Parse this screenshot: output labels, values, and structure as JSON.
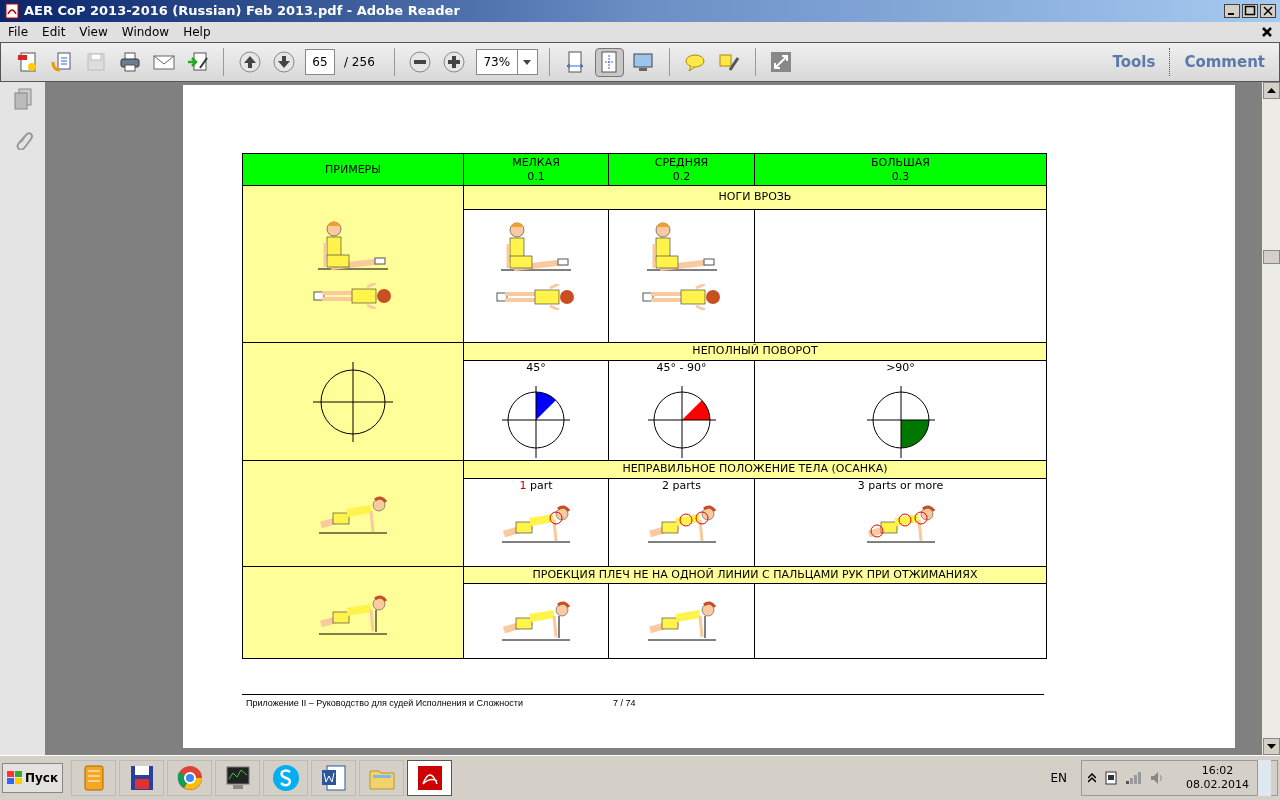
{
  "window": {
    "title": "AER CoP 2013-2016 (Russian) Feb 2013.pdf - Adobe Reader"
  },
  "menu": [
    "File",
    "Edit",
    "View",
    "Window",
    "Help"
  ],
  "toolbar": {
    "page_number": "65",
    "page_total": "/ 256",
    "zoom": "73%",
    "fit_page_selected": true,
    "save_disabled": true,
    "panels": [
      "Tools",
      "Comment"
    ]
  },
  "table": {
    "columns": [
      {
        "label": "ПРИМЕРЫ"
      },
      {
        "label": "МЕЛКАЯ",
        "value": "0.1"
      },
      {
        "label": "СРЕДНЯЯ",
        "value": "0.2"
      },
      {
        "label": "БОЛЬШАЯ",
        "value": "0.3"
      }
    ],
    "sections": [
      {
        "title": "НОГИ ВРОЗЬ"
      },
      {
        "title": "НЕПОЛНЫЙ ПОВОРОТ",
        "cells": [
          {
            "label": "45°",
            "color": "#0000ff"
          },
          {
            "label": "45°  - 90°",
            "color": "#ff0000"
          },
          {
            "label": ">90°",
            "color": "#007700"
          }
        ]
      },
      {
        "title": "НЕПРАВИЛЬНОЕ ПОЛОЖЕНИЕ ТЕЛА (ОСАНКА)",
        "cells": [
          {
            "label": "1 part",
            "number_red": true
          },
          {
            "label": "2 parts",
            "number_red": false
          },
          {
            "label": "3 parts or more",
            "number_red": false
          }
        ]
      },
      {
        "title": "ПРОЕКЦИЯ ПЛЕЧ НЕ НА ОДНОЙ ЛИНИИ С ПАЛЬЦАМИ РУК ПРИ ОТЖИМАНИЯХ"
      }
    ]
  },
  "footer": {
    "text": "Приложение II – Руководство для судей Исполнения и Сложности",
    "page": "7 / 74"
  },
  "taskbar": {
    "start": "Пуск",
    "apps": [
      {
        "kind": "notebook",
        "selected": false
      },
      {
        "kind": "floppy",
        "selected": false
      },
      {
        "kind": "browser",
        "selected": false
      },
      {
        "kind": "monitor",
        "selected": false
      },
      {
        "kind": "skype",
        "selected": false
      },
      {
        "kind": "word",
        "selected": false
      },
      {
        "kind": "folder",
        "selected": false
      },
      {
        "kind": "pdf",
        "selected": true
      }
    ],
    "language": "EN",
    "time": "16:02",
    "date": "08.02.2014"
  }
}
